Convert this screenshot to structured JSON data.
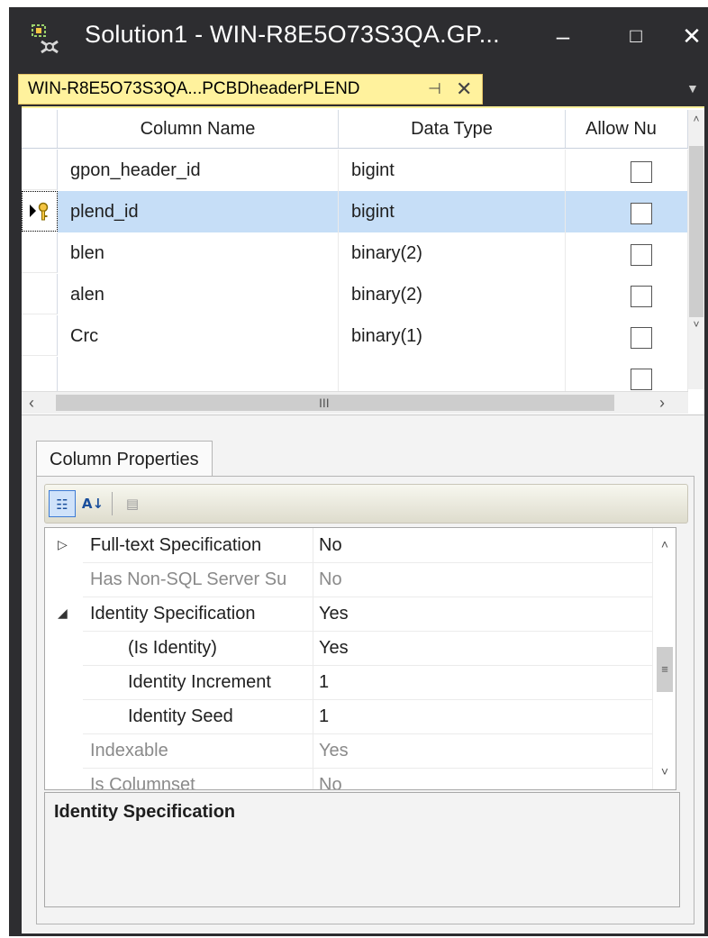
{
  "window": {
    "title": "Solution1 - WIN-R8E5O73S3QA.GP...",
    "minimize": "‒",
    "maximize": "□",
    "close": "✕"
  },
  "document_tab": {
    "label": "WIN-R8E5O73S3QA...PCBDheaderPLEND",
    "pin": "⊣",
    "close": "✕",
    "dropdown": "▼"
  },
  "table": {
    "columns": [
      "Column Name",
      "Data Type",
      "Allow Nu"
    ],
    "rows": [
      {
        "name": "gpon_header_id",
        "type": "bigint",
        "allow_nulls": false
      },
      {
        "name": "plend_id",
        "type": "bigint",
        "allow_nulls": false,
        "primary_key": true,
        "selected": true
      },
      {
        "name": "blen",
        "type": "binary(2)",
        "allow_nulls": false
      },
      {
        "name": "alen",
        "type": "binary(2)",
        "allow_nulls": false
      },
      {
        "name": "Crc",
        "type": "binary(1)",
        "allow_nulls": false
      },
      {
        "name": "",
        "type": "",
        "allow_nulls": false
      }
    ],
    "scroll_grip": "III"
  },
  "properties": {
    "tab_label": "Column Properties",
    "toolbar": {
      "categorized_icon": "categorized-icon",
      "alphabetical_icon": "sort-alphabetical-icon",
      "property_pages_icon": "property-pages-icon"
    },
    "rows": [
      {
        "expander": "▷",
        "name": "Full-text Specification",
        "value": "No",
        "level": 1,
        "dim": false
      },
      {
        "expander": "",
        "name": "Has Non-SQL Server Su",
        "value": "No",
        "level": 1,
        "dim": true
      },
      {
        "expander": "◢",
        "name": "Identity Specification",
        "value": "Yes",
        "level": 1,
        "dim": false
      },
      {
        "expander": "",
        "name": "(Is Identity)",
        "value": "Yes",
        "level": 2,
        "dim": false
      },
      {
        "expander": "",
        "name": "Identity Increment",
        "value": "1",
        "level": 2,
        "dim": false
      },
      {
        "expander": "",
        "name": "Identity Seed",
        "value": "1",
        "level": 2,
        "dim": false
      },
      {
        "expander": "",
        "name": "Indexable",
        "value": "Yes",
        "level": 1,
        "dim": true
      },
      {
        "expander": "",
        "name": "Is Columnset",
        "value": "No",
        "level": 1,
        "dim": true
      }
    ],
    "description_title": "Identity Specification"
  }
}
